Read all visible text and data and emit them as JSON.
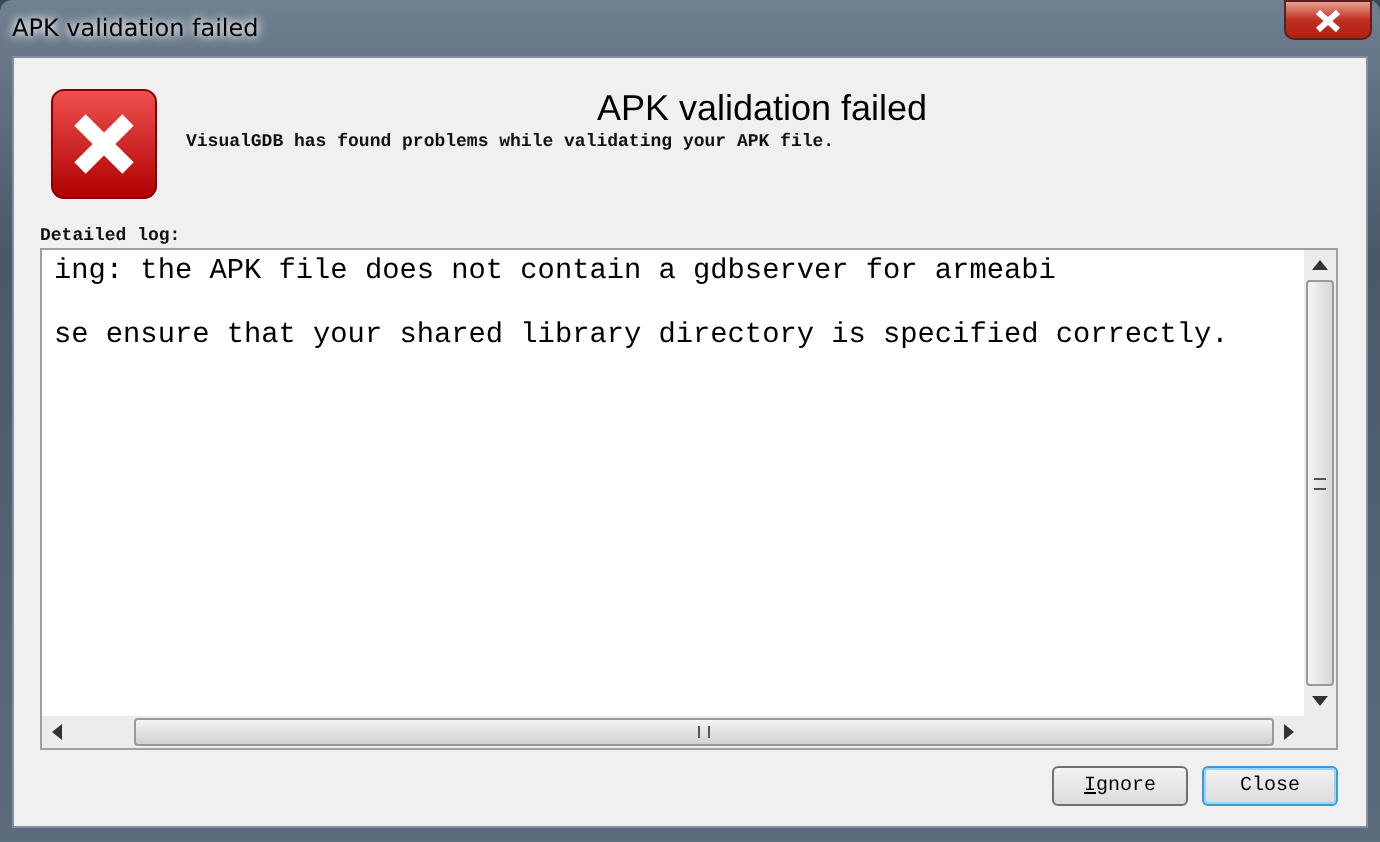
{
  "window": {
    "title": "APK validation failed"
  },
  "header": {
    "heading": "APK validation failed",
    "message": "VisualGDB has found problems while validating your APK file."
  },
  "log": {
    "label": "Detailed log:",
    "lines": [
      "ing: the APK file does not contain a gdbserver for armeabi",
      "se ensure that your shared library directory is specified correctly."
    ]
  },
  "buttons": [
    {
      "label": "Ignore",
      "mnemonic": true,
      "default": false
    },
    {
      "label": "Close",
      "mnemonic": false,
      "default": true
    }
  ]
}
